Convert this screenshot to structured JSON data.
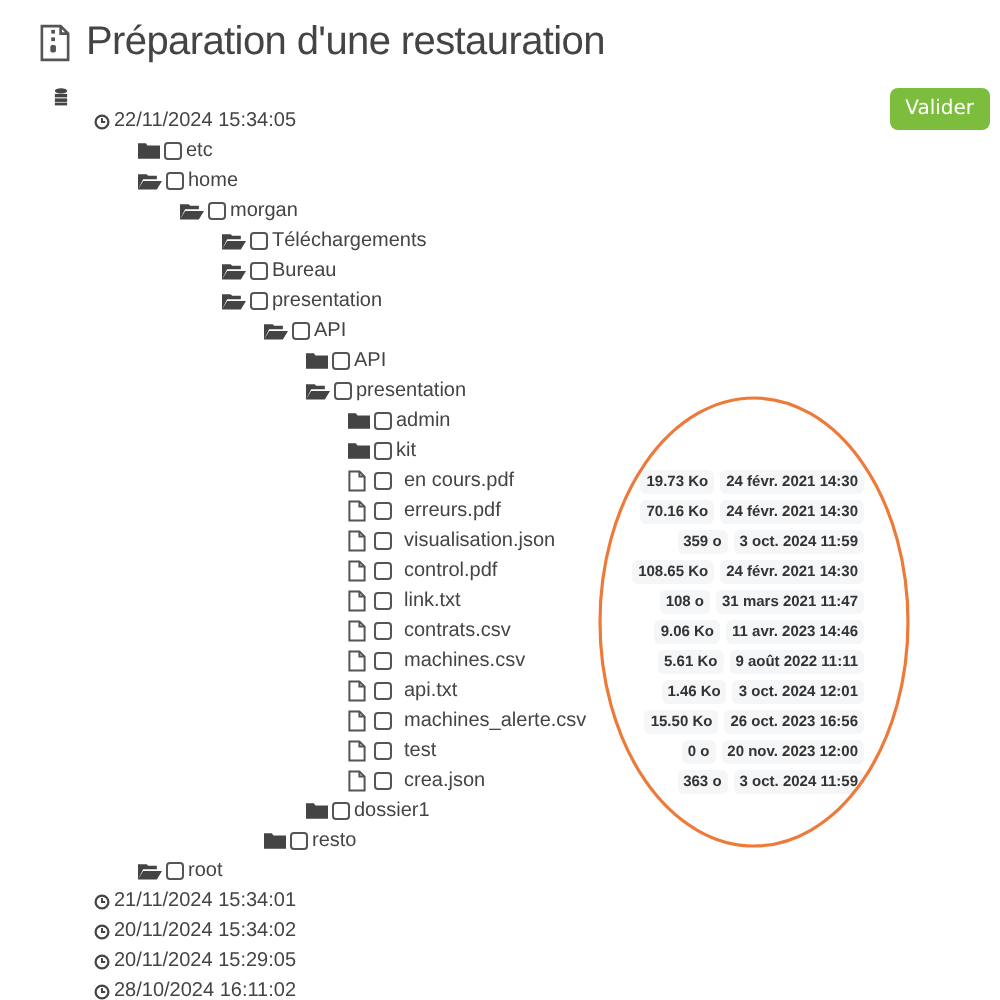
{
  "title": "Préparation d'une restauration",
  "button": "Valider",
  "snapshots": [
    {
      "time": "22/11/2024 15:34:05",
      "children": [
        {
          "kind": "folder",
          "name": "etc",
          "expanded": false,
          "checked": false
        },
        {
          "kind": "folder",
          "name": "home",
          "expanded": true,
          "checked": false,
          "children": [
            {
              "kind": "folder",
              "name": "morgan",
              "expanded": true,
              "checked": false,
              "children": [
                {
                  "kind": "folder",
                  "name": "Téléchargements",
                  "expanded": true,
                  "checked": false
                },
                {
                  "kind": "folder",
                  "name": "Bureau",
                  "expanded": true,
                  "checked": false
                },
                {
                  "kind": "folder",
                  "name": "presentation",
                  "expanded": true,
                  "checked": false,
                  "children": [
                    {
                      "kind": "folder",
                      "name": "API",
                      "expanded": true,
                      "checked": false,
                      "children": [
                        {
                          "kind": "folder",
                          "name": "API",
                          "expanded": false,
                          "checked": false
                        },
                        {
                          "kind": "folder",
                          "name": "presentation",
                          "expanded": true,
                          "checked": false,
                          "children": [
                            {
                              "kind": "folder",
                              "name": "admin",
                              "expanded": false,
                              "checked": false
                            },
                            {
                              "kind": "folder",
                              "name": "kit",
                              "expanded": false,
                              "checked": false
                            },
                            {
                              "kind": "file",
                              "name": "en cours.pdf",
                              "checked": false,
                              "size": "19.73 Ko",
                              "modified": "24 févr. 2021 14:30"
                            },
                            {
                              "kind": "file",
                              "name": "erreurs.pdf",
                              "checked": false,
                              "size": "70.16 Ko",
                              "modified": "24 févr. 2021 14:30"
                            },
                            {
                              "kind": "file",
                              "name": "visualisation.json",
                              "checked": false,
                              "size": "359 o",
                              "modified": "3 oct. 2024 11:59"
                            },
                            {
                              "kind": "file",
                              "name": "control.pdf",
                              "checked": false,
                              "size": "108.65 Ko",
                              "modified": "24 févr. 2021 14:30"
                            },
                            {
                              "kind": "file",
                              "name": "link.txt",
                              "checked": false,
                              "size": "108 o",
                              "modified": "31 mars 2021 11:47"
                            },
                            {
                              "kind": "file",
                              "name": "contrats.csv",
                              "checked": false,
                              "size": "9.06 Ko",
                              "modified": "11 avr. 2023 14:46"
                            },
                            {
                              "kind": "file",
                              "name": "machines.csv",
                              "checked": false,
                              "size": "5.61 Ko",
                              "modified": "9 août 2022 11:11"
                            },
                            {
                              "kind": "file",
                              "name": "api.txt",
                              "checked": false,
                              "size": "1.46 Ko",
                              "modified": "3 oct. 2024 12:01"
                            },
                            {
                              "kind": "file",
                              "name": "machines_alerte.csv",
                              "checked": false,
                              "size": "15.50 Ko",
                              "modified": "26 oct. 2023 16:56"
                            },
                            {
                              "kind": "file",
                              "name": "test",
                              "checked": false,
                              "size": "0 o",
                              "modified": "20 nov. 2023 12:00"
                            },
                            {
                              "kind": "file",
                              "name": "crea.json",
                              "checked": false,
                              "size": "363 o",
                              "modified": "3 oct. 2024 11:59"
                            }
                          ]
                        },
                        {
                          "kind": "folder",
                          "name": "dossier1",
                          "expanded": false,
                          "checked": false
                        }
                      ]
                    },
                    {
                      "kind": "folder",
                      "name": "resto",
                      "expanded": false,
                      "checked": false
                    }
                  ]
                }
              ]
            }
          ]
        },
        {
          "kind": "folder",
          "name": "root",
          "expanded": true,
          "checked": false
        }
      ]
    },
    {
      "time": "21/11/2024 15:34:01"
    },
    {
      "time": "20/11/2024 15:34:02"
    },
    {
      "time": "20/11/2024 15:29:05"
    },
    {
      "time": "28/10/2024 16:11:02"
    }
  ]
}
